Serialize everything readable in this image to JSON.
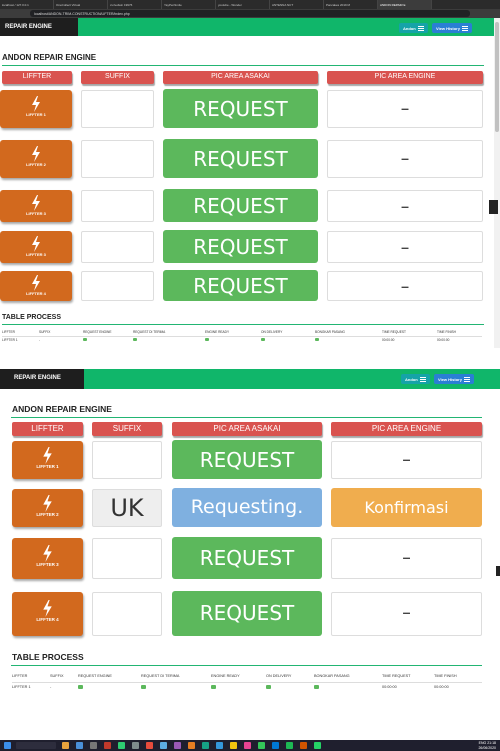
{
  "browser": {
    "tabs": [
      "localhost / 127.0.0.1",
      "OneCollect Virtual",
      "cv.hedwin 19976",
      "YayPenSmile",
      "youtube - Wonder",
      "ANTENNA NCT",
      "Pancakes 2019 M",
      "ANDON REPAIR E"
    ],
    "address": "localhost/ANDON-TRIM-CONSTRUCTION/LIFTER/index.php"
  },
  "nav": {
    "brand": "REPAIR ENGINE",
    "andon_label": "Andon",
    "history_label": "View History"
  },
  "page_title": "ANDON REPAIR ENGINE",
  "columns": [
    "LIFFTER",
    "SUFFIX",
    "PIC AREA ASAKAI",
    "PIC AREA ENGINE"
  ],
  "columns_bottom": [
    "LIFFTER",
    "SUFFIX",
    "PIC AREA ASAKAI",
    "PIC AREA ENGINE"
  ],
  "top_rows": [
    {
      "lifter": "LIFFTER 1",
      "asakai": "REQUEST",
      "engine": "–"
    },
    {
      "lifter": "LIFFTER 2",
      "asakai": "REQUEST",
      "engine": "–"
    },
    {
      "lifter": "LIFFTER 3",
      "asakai": "REQUEST",
      "engine": "–"
    },
    {
      "lifter": "LIFFTER 3",
      "asakai": "REQUEST",
      "engine": "–"
    },
    {
      "lifter": "LIFFTER 4",
      "asakai": "REQUEST",
      "engine": "–"
    }
  ],
  "bottom_rows": [
    {
      "lifter": "LIFFTER 1",
      "suffix": "",
      "asakai": "REQUEST",
      "engine": "–"
    },
    {
      "lifter": "LIFFTER 2",
      "suffix": "UK",
      "asakai": "Requesting.",
      "engine": "Konfirmasi"
    },
    {
      "lifter": "LIFFTER 3",
      "suffix": "",
      "asakai": "REQUEST",
      "engine": "–"
    },
    {
      "lifter": "LIFFTER 4",
      "suffix": "",
      "asakai": "REQUEST",
      "engine": "–"
    }
  ],
  "table_process": {
    "title": "TABLE PROCESS",
    "headers": [
      "LIFFTER",
      "SUFFIX",
      "REQUEST ENGINE",
      "REQUEST DI TERIMA",
      "ENGINE READY",
      "ON DELIVERY",
      "BONGKAR PASANG",
      "TIME REQUEST",
      "TIME FINISH"
    ],
    "row": {
      "lifter": "LIFFTER 1",
      "suffix": "-",
      "time_request": "00:00:00",
      "time_finish": "00:00:00"
    }
  },
  "taskbar": {
    "time": "21:18",
    "date": "26/06/2020",
    "lang": "ENG"
  },
  "colors": {
    "nav_green": "#10b66a",
    "header_red": "#d9534f",
    "lifter_orange": "#d2691e",
    "request_green": "#5cb85c",
    "requesting_blue": "#7fb0e0",
    "konfirmasi_orange": "#f0ad4e"
  }
}
